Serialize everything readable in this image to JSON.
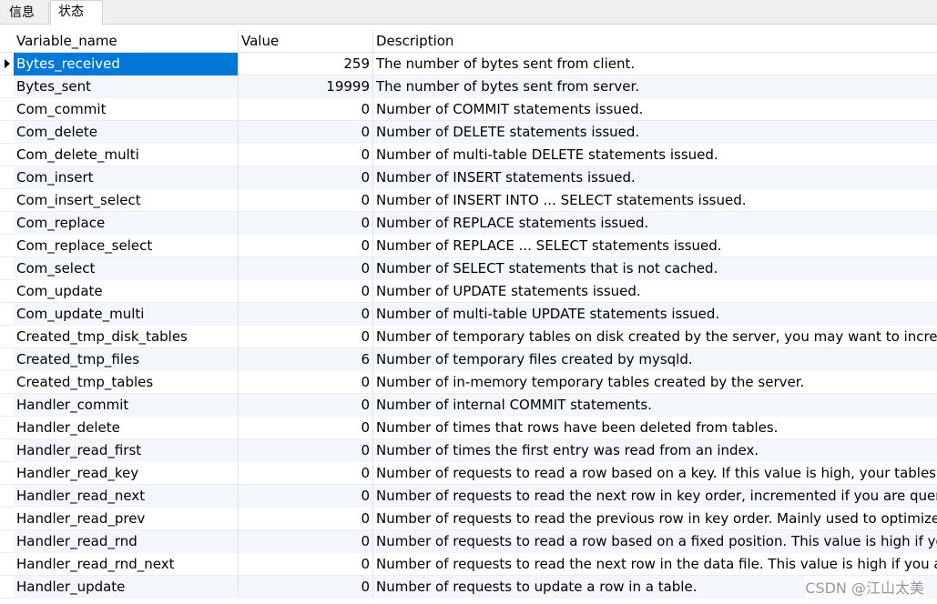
{
  "tabs": [
    {
      "label": "信息",
      "active": false
    },
    {
      "label": "状态",
      "active": true
    }
  ],
  "table": {
    "columns": [
      "Variable_name",
      "Value",
      "Description"
    ],
    "rows": [
      {
        "name": "Bytes_received",
        "value": "259",
        "desc": "The number of bytes sent from client."
      },
      {
        "name": "Bytes_sent",
        "value": "19999",
        "desc": "The number of bytes sent from server."
      },
      {
        "name": "Com_commit",
        "value": "0",
        "desc": "Number of COMMIT statements issued."
      },
      {
        "name": "Com_delete",
        "value": "0",
        "desc": "Number of DELETE statements issued."
      },
      {
        "name": "Com_delete_multi",
        "value": "0",
        "desc": "Number of multi-table DELETE statements issued."
      },
      {
        "name": "Com_insert",
        "value": "0",
        "desc": "Number of INSERT statements issued."
      },
      {
        "name": "Com_insert_select",
        "value": "0",
        "desc": "Number of INSERT INTO ... SELECT statements issued."
      },
      {
        "name": "Com_replace",
        "value": "0",
        "desc": "Number of REPLACE statements issued."
      },
      {
        "name": "Com_replace_select",
        "value": "0",
        "desc": "Number of REPLACE ... SELECT statements issued."
      },
      {
        "name": "Com_select",
        "value": "0",
        "desc": "Number of SELECT statements that is not cached."
      },
      {
        "name": "Com_update",
        "value": "0",
        "desc": "Number of UPDATE statements issued."
      },
      {
        "name": "Com_update_multi",
        "value": "0",
        "desc": "Number of multi-table UPDATE statements issued."
      },
      {
        "name": "Created_tmp_disk_tables",
        "value": "0",
        "desc": "Number of temporary tables on disk created by the server, you may want to increase"
      },
      {
        "name": "Created_tmp_files",
        "value": "6",
        "desc": "Number of temporary files created by mysqld."
      },
      {
        "name": "Created_tmp_tables",
        "value": "0",
        "desc": "Number of in-memory temporary tables created by the server."
      },
      {
        "name": "Handler_commit",
        "value": "0",
        "desc": "Number of internal COMMIT statements."
      },
      {
        "name": "Handler_delete",
        "value": "0",
        "desc": "Number of times that rows have been deleted from tables."
      },
      {
        "name": "Handler_read_first",
        "value": "0",
        "desc": "Number of times the first entry was read from an index."
      },
      {
        "name": "Handler_read_key",
        "value": "0",
        "desc": "Number of requests to read a row based on a key. If this value is high, your tables ma"
      },
      {
        "name": "Handler_read_next",
        "value": "0",
        "desc": "Number of requests to read the next row in key order, incremented if you are queryi"
      },
      {
        "name": "Handler_read_prev",
        "value": "0",
        "desc": "Number of requests to read the previous row in key order. Mainly used to optimize C"
      },
      {
        "name": "Handler_read_rnd",
        "value": "0",
        "desc": "Number of requests to read a row based on a fixed position. This value is high if you a"
      },
      {
        "name": "Handler_read_rnd_next",
        "value": "0",
        "desc": "Number of requests to read the next row in the data file. This value is high if you are d"
      },
      {
        "name": "Handler_update",
        "value": "0",
        "desc": "Number of requests to update a row in a table."
      }
    ],
    "selected_row": 0
  },
  "watermark": "CSDN @江山太美",
  "colors": {
    "selection": "#0078d7",
    "alt_row": "#f3f7fc"
  }
}
